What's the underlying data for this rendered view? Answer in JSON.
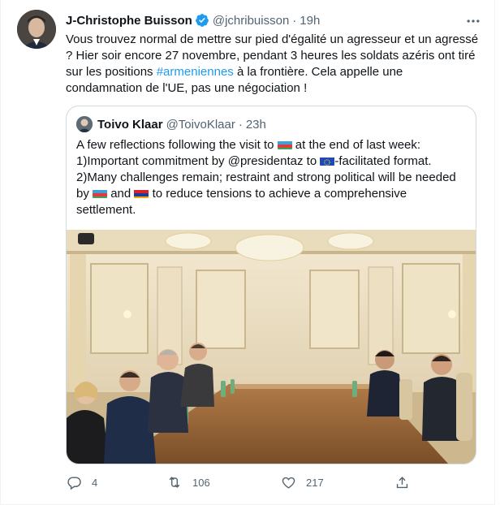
{
  "tweet": {
    "author_name": "J-Christophe Buisson",
    "author_handle": "@jchribuisson",
    "time": "19h",
    "text_before": "Vous trouvez normal de mettre sur pied d'égalité un agresseur et un agressé ? Hier soir encore 27 novembre, pendant 3 heures les soldats azéris ont tiré sur les positions ",
    "hashtag": "#armeniennes",
    "text_after": " à la frontière. Cela appelle une condamnation de l'UE, pas une négociation !",
    "more_icon": "more-icon",
    "verified_icon": "verified-badge-icon"
  },
  "quote": {
    "author_name": "Toivo Klaar",
    "author_handle": "@ToivoKlaar",
    "time": "23h",
    "t1": "A few reflections following the visit to",
    "t2": "at the end of last week:",
    "t3": "1)Important commitment by @presidentaz to",
    "t4": "-facilitated format.",
    "t5": "2)Many challenges remain; restraint and strong political will be needed by",
    "t6": "and",
    "t7": "to reduce tensions to achieve a comprehensive settlement.",
    "flags": [
      "azerbaijan-flag",
      "eu-flag",
      "azerbaijan-flag",
      "armenia-flag"
    ]
  },
  "actions": {
    "reply_count": "4",
    "retweet_count": "106",
    "like_count": "217",
    "icons": [
      "reply-icon",
      "retweet-icon",
      "like-icon",
      "share-icon"
    ]
  },
  "colors": {
    "accent": "#1d9bf0",
    "text": "#0f1419",
    "muted": "#536471",
    "border": "#cfd9de"
  }
}
